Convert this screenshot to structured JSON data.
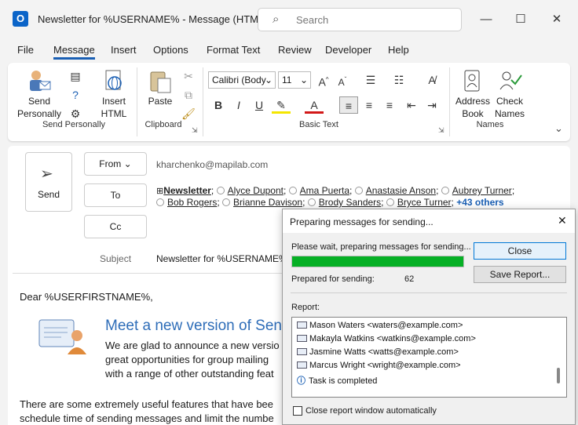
{
  "window": {
    "title": "Newsletter for %USERNAME% - Message (HTML)",
    "app_icon_letter": "O",
    "search_placeholder": "Search",
    "min": "—",
    "max": "☐",
    "close": "✕"
  },
  "menu": [
    "File",
    "Message",
    "Insert",
    "Options",
    "Format Text",
    "Review",
    "Developer",
    "Help"
  ],
  "ribbon": {
    "send_personally": {
      "label1": "Send",
      "label2": "Personally",
      "group": "Send Personally"
    },
    "insert_html": {
      "label1": "Insert",
      "label2": "HTML"
    },
    "paste": {
      "label": "Paste",
      "group": "Clipboard"
    },
    "font_name": "Calibri (Body",
    "font_size": "11",
    "basic_text_group": "Basic Text",
    "address_book": {
      "label1": "Address",
      "label2": "Book"
    },
    "check_names": {
      "label1": "Check",
      "label2": "Names"
    },
    "names_group": "Names",
    "bold": "B",
    "italic": "I",
    "underline": "U"
  },
  "compose": {
    "send": "Send",
    "from": "From",
    "from_address": "kharchenko@mapilab.com",
    "to": "To",
    "cc": "Cc",
    "subject_label": "Subject",
    "subject": "Newsletter for %USERNAME%",
    "recipients_line1": [
      "Newsletter",
      "Alyce Dupont",
      "Ama Puerta",
      "Anastasie Anson",
      "Aubrey Turner"
    ],
    "recipients_line2": [
      "Bob Rogers",
      "Brianne Davison",
      "Brody Sanders",
      "Bryce Turner"
    ],
    "more": "+43 others"
  },
  "body": {
    "greeting": "Dear %USERFIRSTNAME%,",
    "heading": "Meet a new version of Sen",
    "p1": [
      "We are glad to announce a new versio",
      "great opportunities for group mailing",
      "with a range of other outstanding feat"
    ],
    "p2": [
      "There are some extremely useful features that have bee",
      "schedule time of sending messages and limit the numbe"
    ]
  },
  "dialog": {
    "title": "Preparing messages for sending...",
    "wait": "Please wait, preparing messages for sending...",
    "progress": 1.0,
    "prepared_label": "Prepared for sending:",
    "prepared_count": "62",
    "close": "Close",
    "save_report": "Save Report...",
    "report_label": "Report:",
    "report": [
      "Mason Waters <waters@example.com>",
      "Makayla Watkins <watkins@example.com>",
      "Jasmine Watts <watts@example.com>",
      "Marcus Wright <wright@example.com>"
    ],
    "completed": "Task is completed",
    "auto_close": "Close report window automatically"
  }
}
